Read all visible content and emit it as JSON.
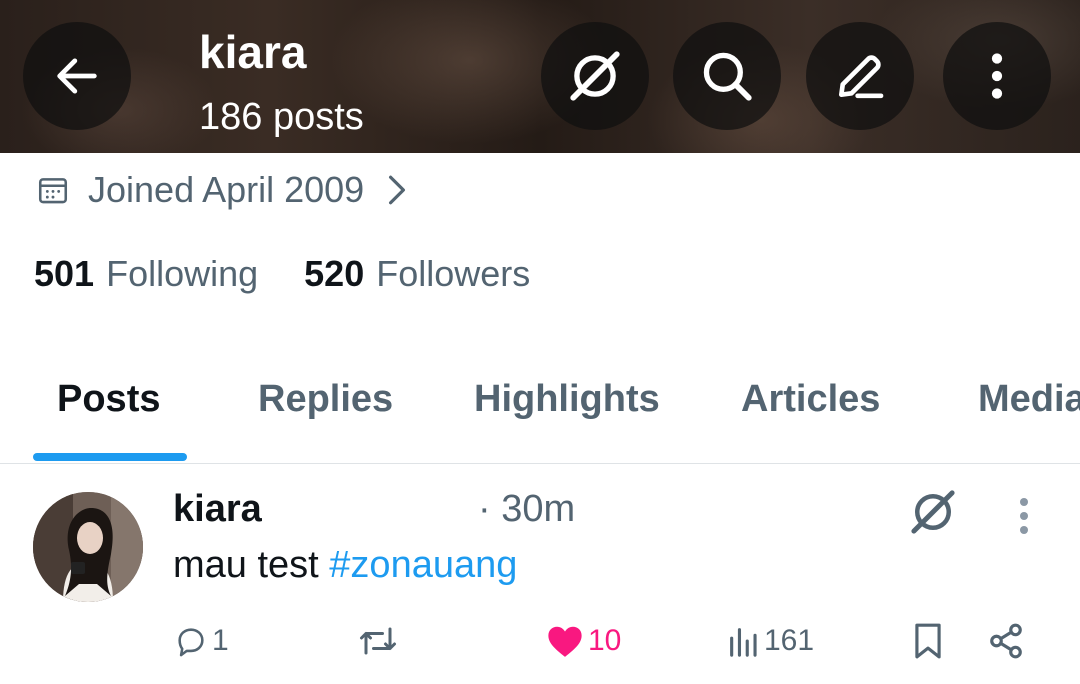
{
  "header": {
    "title": "kiara",
    "post_count": "186 posts",
    "icons": [
      "back-arrow-icon",
      "grok-icon",
      "search-icon",
      "edit-icon",
      "more-vertical-icon"
    ]
  },
  "profile": {
    "joined": "Joined April 2009",
    "following_count": "501",
    "following_label": "Following",
    "followers_count": "520",
    "followers_label": "Followers"
  },
  "tabs": [
    {
      "label": "Posts",
      "active": true
    },
    {
      "label": "Replies"
    },
    {
      "label": "Highlights"
    },
    {
      "label": "Articles"
    },
    {
      "label": "Media"
    }
  ],
  "post": {
    "author": "kiara",
    "time": "· 30m",
    "text": "mau test ",
    "hashtag": "#zonauang",
    "replies": "1",
    "likes": "10",
    "views": "161"
  },
  "colors": {
    "accent": "#1d9bf0",
    "like": "#f91880",
    "secondary_text": "#536471"
  }
}
